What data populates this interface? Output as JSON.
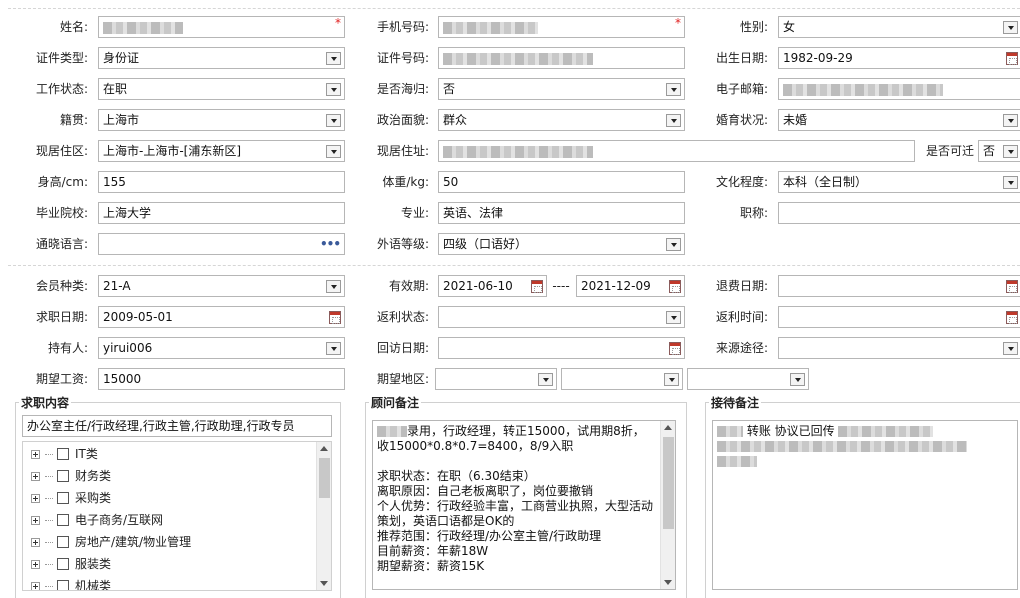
{
  "section1": {
    "name": {
      "label": "姓名:"
    },
    "mobile": {
      "label": "手机号码:"
    },
    "gender": {
      "label": "性别:",
      "value": "女"
    },
    "id_type": {
      "label": "证件类型:",
      "value": "身份证"
    },
    "id_no": {
      "label": "证件号码:"
    },
    "birth": {
      "label": "出生日期:",
      "value": "1982-09-29"
    },
    "work_status": {
      "label": "工作状态:",
      "value": "在职"
    },
    "overseas": {
      "label": "是否海归:",
      "value": "否"
    },
    "email": {
      "label": "电子邮箱:"
    },
    "native": {
      "label": "籍贯:",
      "value": "上海市"
    },
    "politics": {
      "label": "政治面貌:",
      "value": "群众"
    },
    "marital": {
      "label": "婚育状况:",
      "value": "未婚"
    },
    "region": {
      "label": "现居住区:",
      "value": "上海市-上海市-[浦东新区]"
    },
    "address": {
      "label": "现居住址:"
    },
    "relocate": {
      "label": "是否可迁",
      "value": "否"
    },
    "height": {
      "label": "身高/cm:",
      "value": "155"
    },
    "weight": {
      "label": "体重/kg:",
      "value": "50"
    },
    "education": {
      "label": "文化程度:",
      "value": "本科（全日制）"
    },
    "school": {
      "label": "毕业院校:",
      "value": "上海大学"
    },
    "major": {
      "label": "专业:",
      "value": "英语、法律"
    },
    "title": {
      "label": "职称:"
    },
    "language": {
      "label": "通晓语言:",
      "dots": "•••"
    },
    "lang_level": {
      "label": "外语等级:",
      "value": "四级（口语好）"
    }
  },
  "section2": {
    "member_type": {
      "label": "会员种类:",
      "value": "21-A"
    },
    "valid": {
      "label": "有效期:",
      "from": "2021-06-10",
      "sep": "----",
      "to": "2021-12-09"
    },
    "refund_date": {
      "label": "退费日期:"
    },
    "apply_date": {
      "label": "求职日期:",
      "value": "2009-05-01"
    },
    "rebate_status": {
      "label": "返利状态:"
    },
    "rebate_time": {
      "label": "返利时间:"
    },
    "holder": {
      "label": "持有人:",
      "value": "yirui006"
    },
    "visit_date": {
      "label": "回访日期:"
    },
    "source": {
      "label": "来源途径:"
    },
    "salary": {
      "label": "期望工资:",
      "value": "15000"
    },
    "area": {
      "label": "期望地区:"
    }
  },
  "job_panel": {
    "title": "求职内容",
    "summary": "办公室主任/行政经理,行政主管,行政助理,行政专员",
    "tree": [
      "IT类",
      "财务类",
      "采购类",
      "电子商务/互联网",
      "房地产/建筑/物业管理",
      "服装类",
      "机械类"
    ]
  },
  "advisor_panel": {
    "title": "顾问备注",
    "note": "录用，行政经理，转正15000，试用期8折，收15000*0.8*0.7=8400，8/9入职\n\n求职状态：在职（6.30结束）\n离职原因：自己老板离职了，岗位要撤销\n个人优势：行政经验丰富，工商营业执照，大型活动策划，英语口语都是OK的\n推荐范围：行政经理/办公室主管/行政助理\n目前薪资：年薪18W\n期望薪资：薪资15K"
  },
  "reception_panel": {
    "title": "接待备注",
    "note": "转账 协议已回传"
  },
  "colors": {
    "required": "#e02020",
    "border": "#b6b6b6",
    "separator": "#d6d6d6"
  }
}
